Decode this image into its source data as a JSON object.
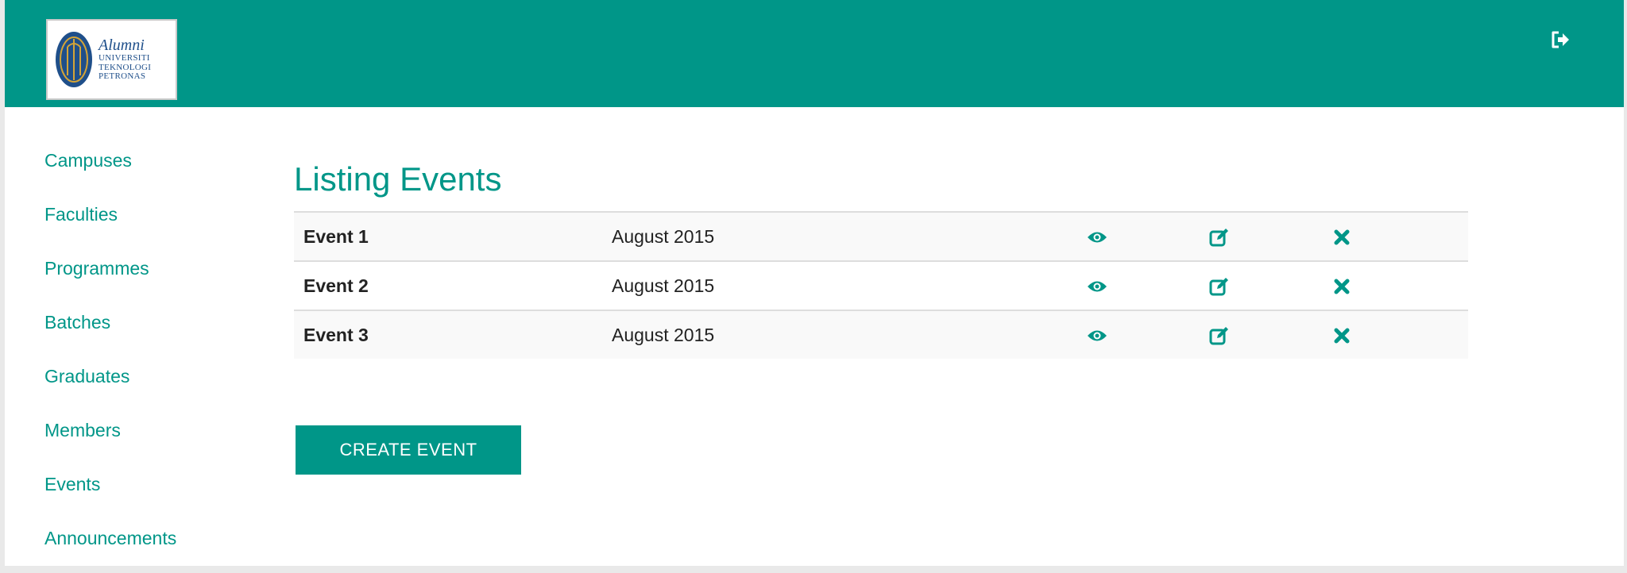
{
  "header": {
    "logo": {
      "script": "Alumni",
      "lines": [
        "UNIVERSITI",
        "TEKNOLOGI",
        "PETRONAS"
      ]
    },
    "logout_icon": "sign-out-icon"
  },
  "sidebar": {
    "items": [
      {
        "label": "Campuses"
      },
      {
        "label": "Faculties"
      },
      {
        "label": "Programmes"
      },
      {
        "label": "Batches"
      },
      {
        "label": "Graduates"
      },
      {
        "label": "Members"
      },
      {
        "label": "Events"
      },
      {
        "label": "Announcements"
      }
    ]
  },
  "main": {
    "title": "Listing Events",
    "events": [
      {
        "name": "Event 1",
        "date": "August 2015"
      },
      {
        "name": "Event 2",
        "date": "August 2015"
      },
      {
        "name": "Event 3",
        "date": "August 2015"
      }
    ],
    "row_actions": [
      "eye-icon",
      "edit-icon",
      "delete-icon"
    ],
    "create_button": "CREATE EVENT"
  },
  "colors": {
    "accent": "#009688",
    "row_stripe": "#f9f9f9",
    "border": "#dddddd"
  }
}
